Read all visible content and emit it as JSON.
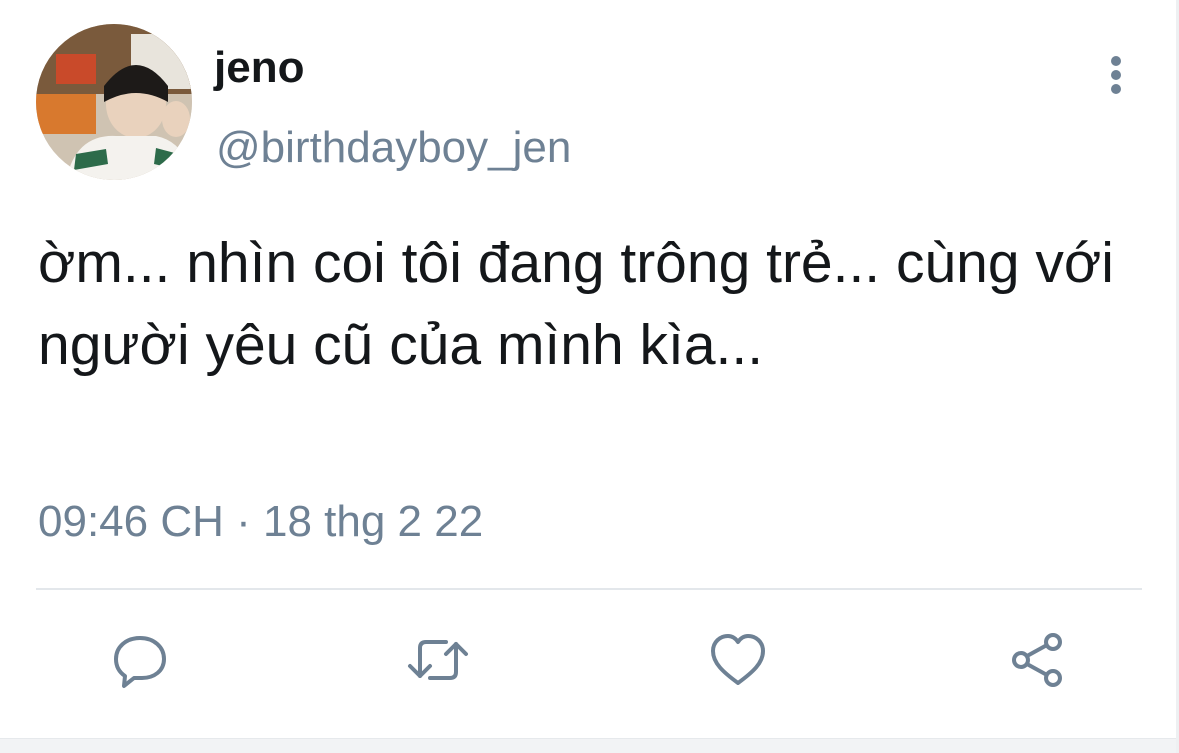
{
  "tweet": {
    "display_name": "jeno",
    "handle": "@birthdayboy_jen",
    "text": "ờm... nhìn coi tôi đang trông trẻ... cùng với người yêu cũ của mình kìa...",
    "timestamp": "09:46 CH · 18 thg 2 22"
  },
  "icons": {
    "more": "more-vertical-icon",
    "reply": "reply-icon",
    "retweet": "retweet-icon",
    "like": "heart-icon",
    "share": "share-icon"
  },
  "colors": {
    "text_primary": "#14171a",
    "text_secondary": "#6e8194",
    "divider": "#e3e7eb"
  }
}
